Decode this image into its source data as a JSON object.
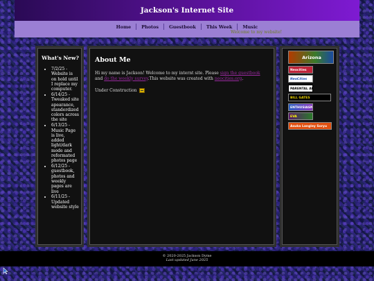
{
  "header": {
    "title": "Jackson's Internet Site"
  },
  "nav": {
    "links": [
      "Home",
      "Photos",
      "Guestbook",
      "This Week",
      "Music"
    ],
    "marquee": "Welcome to my website!"
  },
  "sidebar": {
    "heading": "What's New?",
    "news": [
      "7/2/25 - Website is on hold until I replace my computer.",
      "6/14/25 - Tweaked site apearance, standerdized colors across the site",
      "6/13/25 - Music Page is live, added light/dark mode and reformated photos page",
      "6/12/25 - guestbook, photos and weekly pages are live",
      "6/11/25 - Updated website style"
    ]
  },
  "main": {
    "heading": "About Me",
    "intro_1": "Hi my name is Jackson! Welcome to my internt site. Please ",
    "link_guestbook": "sign the guestbook",
    "intro_2": " and ",
    "link_weekly": "do the weekly survey",
    "intro_3": ".This website was created with ",
    "link_neocities": "neocities.org",
    "intro_4": ".",
    "construction": "Under Construction"
  },
  "badges": {
    "arizona": "Arizona",
    "b1": "Neocities",
    "neocities": "NeoCities",
    "advisory": "PARENTAL ADVISORY",
    "bill_gates": "BILL GATES",
    "enthusiasm": "ENTHUSIASM",
    "eva": "EVA",
    "asuka": "Asuka Langley Soryu"
  },
  "footer": {
    "copyright": "© 2020-2025 Jackson Dyme",
    "updated": "Last updated June 2025"
  },
  "colors": {
    "header_gradient_start": "#2a0a55",
    "header_gradient_end": "#7e1ad2",
    "nav_bg": "#9b7fd4",
    "link": "#9a2aa0",
    "panel_bg": "#111111"
  }
}
